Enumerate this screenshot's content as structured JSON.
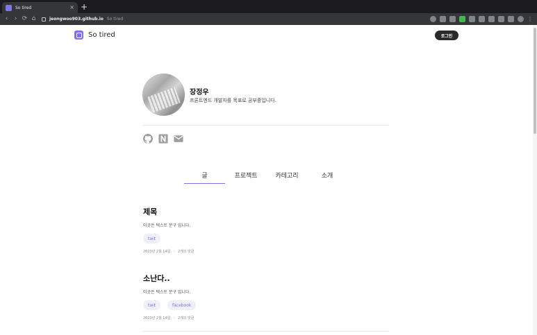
{
  "browser": {
    "tab_title": "So tired",
    "tab_close": "×",
    "new_tab": "+",
    "url_host": "jeongwoo903.github.io",
    "url_path": "So tired",
    "nav": {
      "back": "‹",
      "forward": "›",
      "reload": "⟳",
      "home": "⌂"
    },
    "toolbar_icons": [
      "shield-icon",
      "star-icon",
      "puzzle-icon",
      "extension-green-icon",
      "extension-b-icon",
      "download-icon",
      "screenshot-icon",
      "panel-icon",
      "sidebar-icon",
      "profile-icon",
      "menu-icon"
    ],
    "menu_glyph": "⋮"
  },
  "header": {
    "site_title": "So tired",
    "login_label": "로그인"
  },
  "profile": {
    "name": "장정우",
    "description": "프론트엔드 개발자를 목표로 공부중입니다."
  },
  "tabs": [
    {
      "label": "글",
      "active": true
    },
    {
      "label": "프로젝트",
      "active": false
    },
    {
      "label": "카테고리",
      "active": false
    },
    {
      "label": "소개",
      "active": false
    }
  ],
  "posts": [
    {
      "title": "제목",
      "excerpt": "이곳은 텍스트 문구 입니다.",
      "tags": [
        "twit"
      ],
      "date": "2020년 2월 14일",
      "separator": "·",
      "comments": "2개의 댓글"
    },
    {
      "title": "소난다..",
      "excerpt": "이곳은 텍스트 문구 입니다.",
      "tags": [
        "twit",
        "facebook"
      ],
      "date": "2020년 2월 14일",
      "separator": "·",
      "comments": "2개의 댓글"
    }
  ],
  "colors": {
    "accent": "#7c6ff0",
    "tag_bg": "#eef0f6",
    "chrome_dark": "#1b1b1d",
    "chrome_toolbar": "#35363a"
  }
}
